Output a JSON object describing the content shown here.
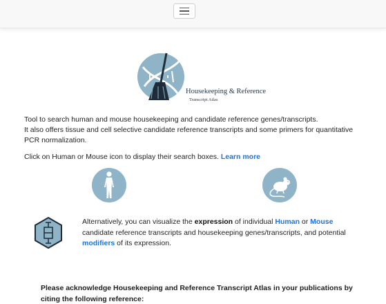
{
  "navbar": {
    "menu_icon": "hamburger-menu-icon"
  },
  "logo": {
    "icon": "broom-dna-logo-icon",
    "title": "Housekeeping & Reference",
    "subtitle": "Transcript Atlas"
  },
  "intro": {
    "line1": "Tool to search human and mouse housekeeping and candidate reference genes/transcripts.",
    "line2": "It also offers tissue and cell selective candidate reference transcripts and some primers for quantitative PCR normalization.",
    "instruction": "Click on Human or Mouse icon to display their search boxes.",
    "learn_more": "Learn more"
  },
  "species": {
    "human_icon": "human-body-icon",
    "mouse_icon": "mouse-icon"
  },
  "alternative": {
    "icon": "hexagon-boxplot-icon",
    "t1": "Alternatively, you can visualize the ",
    "expression": "expression",
    "t2": " of individual ",
    "human": "Human",
    "t3": " or ",
    "mouse": "Mouse",
    "t4": " candidate reference transcripts and housekeeping genes/transcripts, and potential ",
    "modifiers": "modifiers",
    "t5": " of its expression."
  },
  "acknowledge": "Please acknowledge Housekeeping and Reference Transcript Atlas in your publications by citing the following reference:",
  "colors": {
    "link": "#1a73e8",
    "icon_bg": "#8fb4c8",
    "logo_dark": "#1e2b38"
  }
}
